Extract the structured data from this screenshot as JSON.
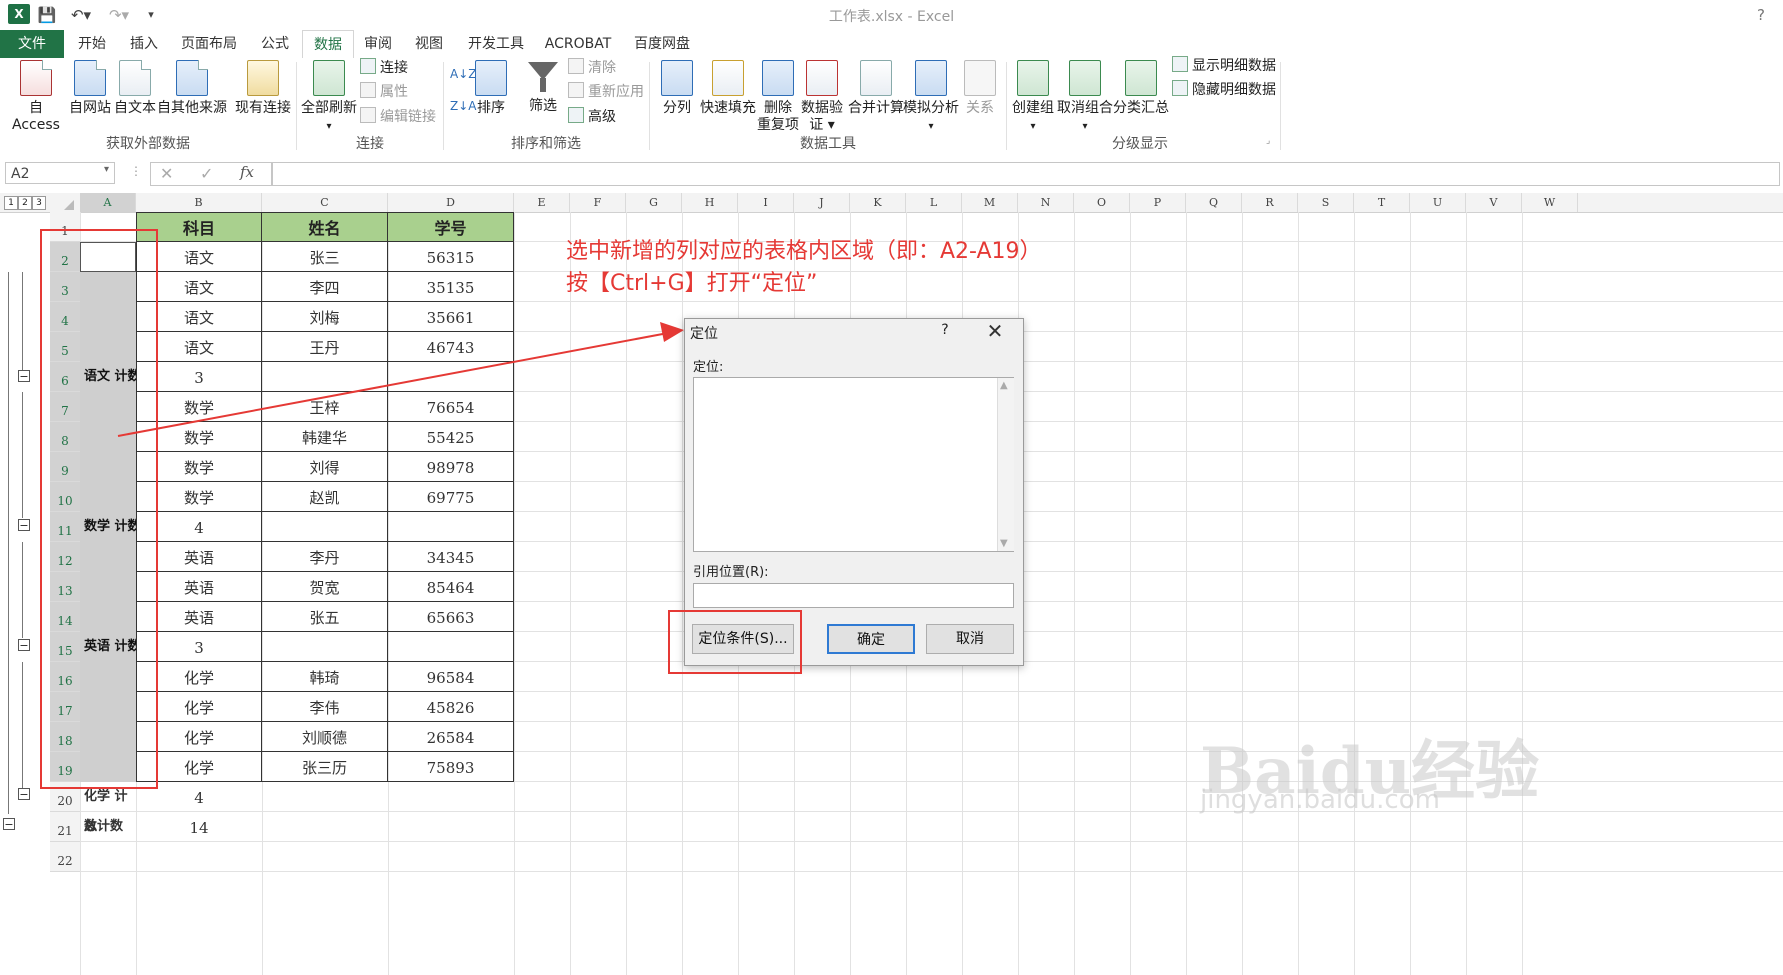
{
  "window": {
    "title": "工作表.xlsx - Excel",
    "help": "?"
  },
  "tabs": [
    "文件",
    "开始",
    "插入",
    "页面布局",
    "公式",
    "数据",
    "审阅",
    "视图",
    "开发工具",
    "ACROBAT",
    "百度网盘"
  ],
  "ribbon": {
    "get_external": {
      "buttons": [
        "自 Access",
        "自网站",
        "自文本",
        "自其他来源",
        "现有连接"
      ],
      "label": "获取外部数据"
    },
    "connections": {
      "refresh": "全部刷新",
      "connect": "连接",
      "properties": "属性",
      "edit_links": "编辑链接",
      "label": "连接"
    },
    "sort_filter": {
      "sort": "排序",
      "filter": "筛选",
      "clear": "清除",
      "reapply": "重新应用",
      "advanced": "高级",
      "label": "排序和筛选"
    },
    "data_tools": {
      "text_to_cols": "分列",
      "flash_fill": "快速填充",
      "remove_dup_1": "删除",
      "remove_dup_2": "重复项",
      "validation_1": "数据验",
      "validation_2": "证 ▾",
      "consolidate": "合并计算",
      "whatif": "模拟分析",
      "relations": "关系",
      "label": "数据工具"
    },
    "outline": {
      "group": "创建组",
      "ungroup": "取消组合",
      "subtotal": "分类汇总",
      "show_detail": "显示明细数据",
      "hide_detail": "隐藏明细数据",
      "label": "分级显示"
    }
  },
  "formula_bar": {
    "name_box": "A2",
    "fx": "fx",
    "cancel": "✕",
    "enter": "✓"
  },
  "columns": [
    "A",
    "B",
    "C",
    "D",
    "E",
    "F",
    "G",
    "H",
    "I",
    "J",
    "K",
    "L",
    "M",
    "N",
    "O",
    "P",
    "Q",
    "R",
    "S",
    "T",
    "U",
    "V",
    "W"
  ],
  "outline_levels": [
    "1",
    "2",
    "3"
  ],
  "table_header": [
    "科目",
    "姓名",
    "学号"
  ],
  "rows": [
    {
      "n": "1",
      "a": "",
      "b": "",
      "c": "",
      "d": ""
    },
    {
      "n": "2",
      "a": "",
      "b": "语文",
      "c": "张三",
      "d": "56315"
    },
    {
      "n": "3",
      "a": "",
      "b": "语文",
      "c": "李四",
      "d": "35135"
    },
    {
      "n": "4",
      "a": "",
      "b": "语文",
      "c": "刘梅",
      "d": "35661"
    },
    {
      "n": "5",
      "a": "",
      "b": "语文",
      "c": "王丹",
      "d": "46743"
    },
    {
      "n": "6",
      "a": "语文 计数",
      "b": "3",
      "c": "",
      "d": ""
    },
    {
      "n": "7",
      "a": "",
      "b": "数学",
      "c": "王梓",
      "d": "76654"
    },
    {
      "n": "8",
      "a": "",
      "b": "数学",
      "c": "韩建华",
      "d": "55425"
    },
    {
      "n": "9",
      "a": "",
      "b": "数学",
      "c": "刘得",
      "d": "98978"
    },
    {
      "n": "10",
      "a": "",
      "b": "数学",
      "c": "赵凯",
      "d": "69775"
    },
    {
      "n": "11",
      "a": "数学 计数",
      "b": "4",
      "c": "",
      "d": ""
    },
    {
      "n": "12",
      "a": "",
      "b": "英语",
      "c": "李丹",
      "d": "34345"
    },
    {
      "n": "13",
      "a": "",
      "b": "英语",
      "c": "贺宽",
      "d": "85464"
    },
    {
      "n": "14",
      "a": "",
      "b": "英语",
      "c": "张五",
      "d": "65663"
    },
    {
      "n": "15",
      "a": "英语 计数",
      "b": "3",
      "c": "",
      "d": ""
    },
    {
      "n": "16",
      "a": "",
      "b": "化学",
      "c": "韩琦",
      "d": "96584"
    },
    {
      "n": "17",
      "a": "",
      "b": "化学",
      "c": "李伟",
      "d": "45826"
    },
    {
      "n": "18",
      "a": "",
      "b": "化学",
      "c": "刘顺德",
      "d": "26584"
    },
    {
      "n": "19",
      "a": "",
      "b": "化学",
      "c": "张三历",
      "d": "75893"
    },
    {
      "n": "20",
      "a": "化学 计数",
      "b": "4",
      "c": "",
      "d": ""
    },
    {
      "n": "21",
      "a": "总计数",
      "b": "14",
      "c": "",
      "d": ""
    },
    {
      "n": "22",
      "a": "",
      "b": "",
      "c": "",
      "d": ""
    }
  ],
  "annotation": {
    "line1": "选中新增的列对应的表格内区域（即：A2-A19）",
    "line2": "按【Ctrl+G】打开“定位”"
  },
  "dialog": {
    "title": "定位",
    "help": "?",
    "close": "✕",
    "goto_label": "定位:",
    "ref_label": "引用位置(R):",
    "special_btn": "定位条件(S)...",
    "ok_btn": "确定",
    "cancel_btn": "取消"
  },
  "watermark": {
    "logo": "Baidu经验",
    "url": "jingyan.baidu.com"
  }
}
